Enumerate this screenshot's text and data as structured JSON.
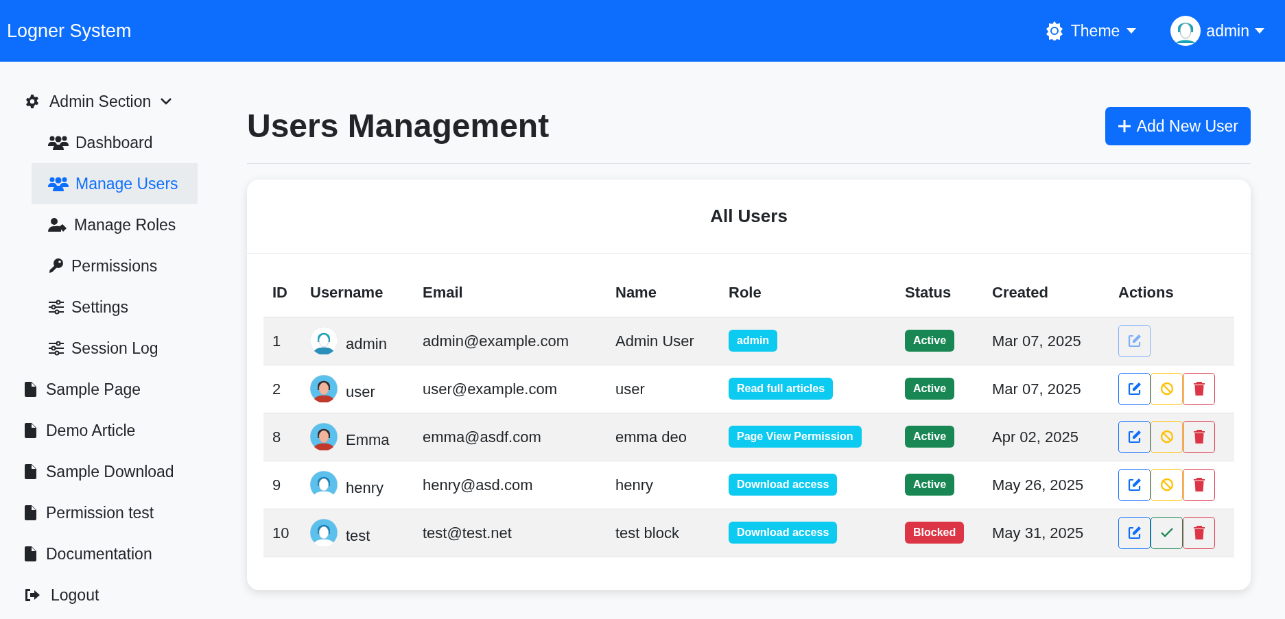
{
  "navbar": {
    "brand": "Logner System",
    "theme_menu": {
      "label": "Theme"
    },
    "user_menu": {
      "label": "admin"
    }
  },
  "sidebar": {
    "items": [
      {
        "label": "Admin Section",
        "kind": "gear",
        "expanded": true,
        "selected": false,
        "children": [
          {
            "label": "Dashboard",
            "kind": "users",
            "selected": false
          },
          {
            "label": "Manage Users",
            "kind": "users",
            "selected": true
          },
          {
            "label": "Manage Roles",
            "kind": "user-tag",
            "selected": false
          },
          {
            "label": "Permissions",
            "kind": "key",
            "selected": false
          },
          {
            "label": "Settings",
            "kind": "sliders",
            "selected": false
          },
          {
            "label": "Session Log",
            "kind": "sliders",
            "selected": false
          }
        ]
      },
      {
        "label": "Sample Page",
        "kind": "file",
        "selected": false
      },
      {
        "label": "Demo Article",
        "kind": "file",
        "selected": false
      },
      {
        "label": "Sample Download",
        "kind": "file",
        "selected": false
      },
      {
        "label": "Permission test",
        "kind": "file",
        "selected": false
      },
      {
        "label": "Documentation",
        "kind": "file",
        "selected": false
      },
      {
        "label": "Logout",
        "kind": "logout",
        "selected": false
      }
    ]
  },
  "page": {
    "title": "Users Management",
    "add_button": "Add New User"
  },
  "table": {
    "title": "All Users",
    "columns": [
      "ID",
      "Username",
      "Email",
      "Name",
      "Role",
      "Status",
      "Created",
      "Actions"
    ],
    "rows": [
      {
        "id": "1",
        "avatar": {
          "kind": "man-light"
        },
        "username": "admin",
        "email": "admin@example.com",
        "name": "Admin User",
        "role": "admin",
        "status": {
          "label": "Active",
          "kind": "active"
        },
        "created": "Mar 07, 2025",
        "actions": [
          {
            "kind": "edit",
            "disabled": true
          }
        ]
      },
      {
        "id": "2",
        "avatar": {
          "kind": "woman"
        },
        "username": "user",
        "email": "user@example.com",
        "name": "user",
        "role": "Read full articles",
        "status": {
          "label": "Active",
          "kind": "active"
        },
        "created": "Mar 07, 2025",
        "actions": [
          {
            "kind": "edit",
            "disabled": false
          },
          {
            "kind": "block",
            "disabled": false
          },
          {
            "kind": "delete",
            "disabled": false
          }
        ]
      },
      {
        "id": "8",
        "avatar": {
          "kind": "woman"
        },
        "username": "Emma",
        "email": "emma@asdf.com",
        "name": "emma deo",
        "role": "Page View Permission",
        "status": {
          "label": "Active",
          "kind": "active"
        },
        "created": "Apr 02, 2025",
        "actions": [
          {
            "kind": "edit",
            "disabled": false
          },
          {
            "kind": "block",
            "disabled": false
          },
          {
            "kind": "delete",
            "disabled": false
          }
        ]
      },
      {
        "id": "9",
        "avatar": {
          "kind": "man"
        },
        "username": "henry",
        "email": "henry@asd.com",
        "name": "henry",
        "role": "Download access",
        "status": {
          "label": "Active",
          "kind": "active"
        },
        "created": "May 26, 2025",
        "actions": [
          {
            "kind": "edit",
            "disabled": false
          },
          {
            "kind": "block",
            "disabled": false
          },
          {
            "kind": "delete",
            "disabled": false
          }
        ]
      },
      {
        "id": "10",
        "avatar": {
          "kind": "man"
        },
        "username": "test",
        "email": "test@test.net",
        "name": "test block",
        "role": "Download access",
        "status": {
          "label": "Blocked",
          "kind": "blocked"
        },
        "created": "May 31, 2025",
        "actions": [
          {
            "kind": "edit",
            "disabled": false
          },
          {
            "kind": "unblock",
            "disabled": false
          },
          {
            "kind": "delete",
            "disabled": false
          }
        ]
      }
    ]
  }
}
